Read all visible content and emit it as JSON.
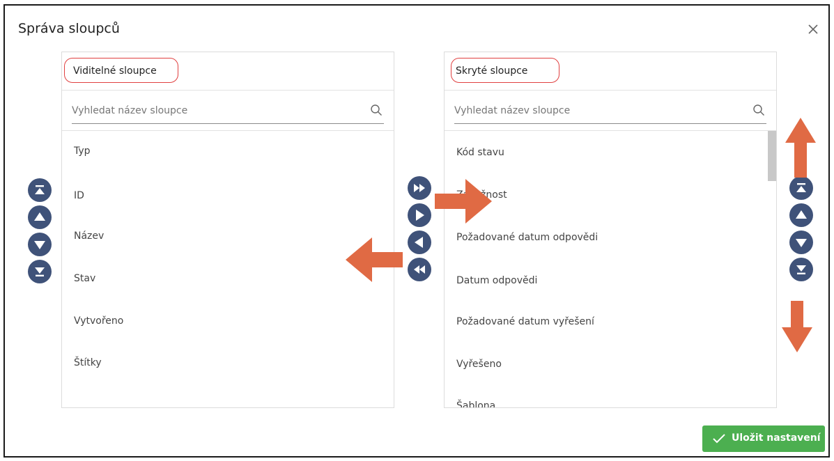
{
  "dialog": {
    "title": "Správa sloupců"
  },
  "visible_panel": {
    "title": "Viditelné sloupce",
    "search_placeholder": "Vyhledat název sloupce",
    "search_value": "",
    "items": [
      "Typ",
      "ID",
      "Název",
      "Stav",
      "Vytvořeno",
      "Štítky"
    ]
  },
  "hidden_panel": {
    "title": "Skryté sloupce",
    "search_placeholder": "Vyhledat název sloupce",
    "search_value": "",
    "items": [
      "Kód stavu",
      "Závažnost",
      "Požadované datum odpovědi",
      "Datum odpovědi",
      "Požadované datum vyřešení",
      "Vyřešeno",
      "Šablona"
    ]
  },
  "save_button": {
    "label": "Uložit nastavení"
  },
  "colors": {
    "nav_button": "#3f5279",
    "annotation_arrow": "#e06a44",
    "highlight_outline": "#e04040",
    "save_button": "#4caf50"
  }
}
